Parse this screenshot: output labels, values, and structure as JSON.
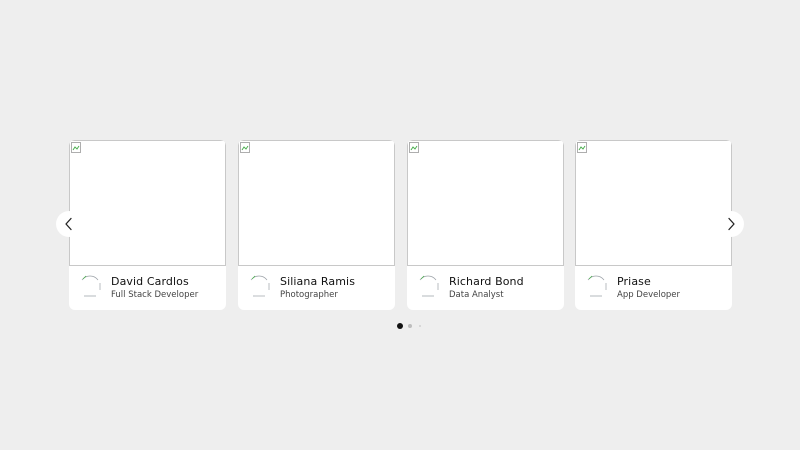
{
  "cards": [
    {
      "name": "David Cardlos",
      "role": "Full Stack Developer"
    },
    {
      "name": "Siliana Ramis",
      "role": "Photographer"
    },
    {
      "name": "Richard Bond",
      "role": "Data Analyst"
    },
    {
      "name": "Priase",
      "role": "App Developer"
    }
  ],
  "navigation": {
    "prev_icon": "chevron-left-icon",
    "next_icon": "chevron-right-icon"
  },
  "pagination": {
    "total_dots": 3,
    "active_index": 0
  },
  "colors": {
    "background": "#eeeeee",
    "card": "#ffffff",
    "dot_active": "#111111",
    "dot_inactive": "#bbbbbb"
  }
}
